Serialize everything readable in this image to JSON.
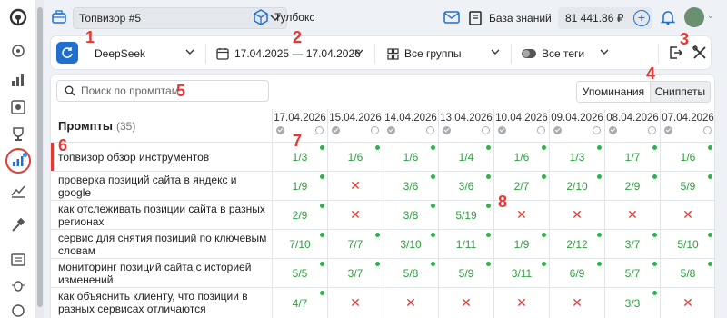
{
  "topbar": {
    "project": "Топвизор #5",
    "toolbox": "Тулбокс",
    "knowledge_base": "База знаний",
    "balance": "81 441.86 ₽"
  },
  "filters": {
    "engine": "DeepSeek",
    "date_range": "17.04.2025 — 17.04.2026",
    "groups": "Все группы",
    "tags": "Все теги"
  },
  "search": {
    "placeholder": "Поиск по промптам",
    "value": ""
  },
  "tabs": [
    "Упоминания",
    "Сниппеты"
  ],
  "table": {
    "title": "Промпты",
    "count": "(35)",
    "dates": [
      "17.04.2026",
      "15.04.2026",
      "14.04.2026",
      "13.04.2026",
      "10.04.2026",
      "09.04.2026",
      "08.04.2026",
      "07.04.2026"
    ],
    "rows": [
      {
        "prompt": "топвизор обзор инструментов",
        "cells": [
          "1/3",
          "1/6",
          "1/6",
          "1/4",
          "1/6",
          "1/3",
          "1/7",
          "1/6"
        ]
      },
      {
        "prompt": "проверка позиций сайта в яндекс и google",
        "cells": [
          "1/9",
          "✕",
          "3/6",
          "3/6",
          "2/7",
          "2/10",
          "2/9",
          "5/9"
        ]
      },
      {
        "prompt": "как отслеживать позиции сайта в разных регионах",
        "cells": [
          "2/9",
          "✕",
          "3/8",
          "5/19",
          "✕",
          "✕",
          "✕",
          "✕"
        ]
      },
      {
        "prompt": "сервис для снятия позиций по ключевым словам",
        "cells": [
          "7/10",
          "7/7",
          "3/10",
          "1/11",
          "1/9",
          "2/12",
          "3/7",
          "5/10"
        ]
      },
      {
        "prompt": "мониторинг позиций сайта с историей изменений",
        "cells": [
          "5/5",
          "3/7",
          "5/8",
          "5/9",
          "3/11",
          "6/9",
          "5/7",
          "5/8"
        ]
      },
      {
        "prompt": "как объяснить клиенту, что позиции в разных сервисах отличаются",
        "cells": [
          "4/7",
          "✕",
          "✕",
          "✕",
          "✕",
          "✕",
          "3/3",
          "✕"
        ]
      }
    ]
  },
  "annotations": [
    "1",
    "2",
    "3",
    "4",
    "5",
    "6",
    "7",
    "8"
  ],
  "colors": {
    "accent": "#1e6fd0",
    "success": "#2e9e3f",
    "error": "#e53935"
  }
}
